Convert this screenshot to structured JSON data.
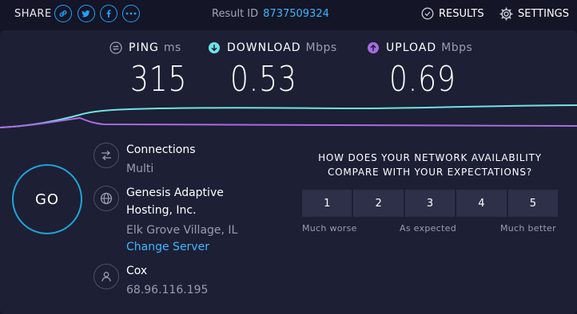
{
  "header": {
    "share_label": "SHARE",
    "share_icons": [
      "link-icon",
      "twitter-icon",
      "facebook-icon",
      "more-icon"
    ],
    "result_id_label": "Result ID",
    "result_id": "8737509324",
    "results_label": "RESULTS",
    "settings_label": "SETTINGS"
  },
  "metrics": {
    "ping": {
      "label": "PING",
      "unit": "ms",
      "value": "315"
    },
    "download": {
      "label": "DOWNLOAD",
      "unit": "Mbps",
      "value": "0.53"
    },
    "upload": {
      "label": "UPLOAD",
      "unit": "Mbps",
      "value": "0.69"
    }
  },
  "go_label": "GO",
  "connections": {
    "title": "Connections",
    "value": "Multi"
  },
  "server": {
    "name_line1": "Genesis Adaptive",
    "name_line2": "Hosting, Inc.",
    "location": "Elk Grove Village, IL",
    "change_label": "Change Server"
  },
  "isp": {
    "name": "Cox",
    "ip": "68.96.116.195"
  },
  "survey": {
    "question_line1": "HOW DOES YOUR NETWORK AVAILABILITY",
    "question_line2": "COMPARE WITH YOUR EXPECTATIONS?",
    "options": [
      "1",
      "2",
      "3",
      "4",
      "5"
    ],
    "scale_low": "Much worse",
    "scale_mid": "As expected",
    "scale_high": "Much better"
  },
  "colors": {
    "accent": "#39b7ff",
    "download": "#6fe3e6",
    "upload": "#a86ce0",
    "background": "#141526",
    "panel": "#1d1f34"
  }
}
